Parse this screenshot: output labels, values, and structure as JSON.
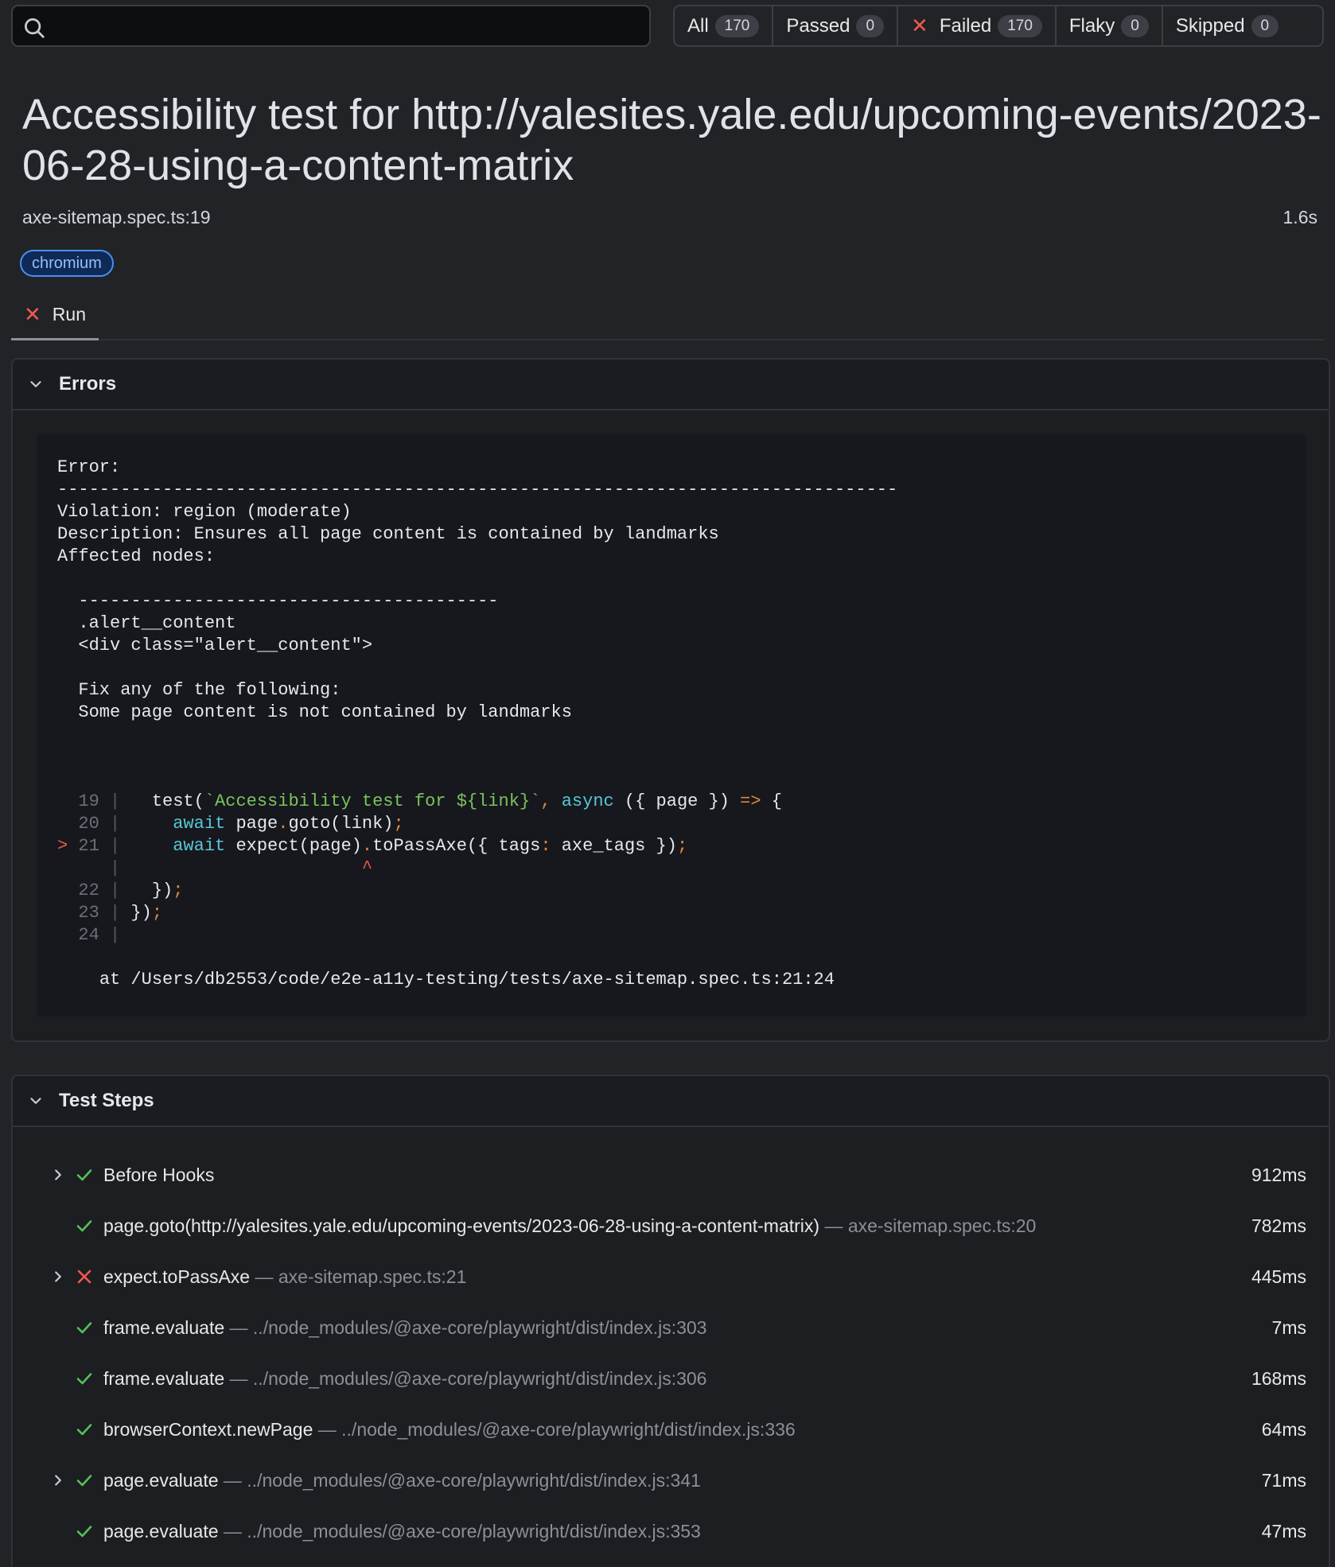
{
  "search": {
    "placeholder": ""
  },
  "filters": [
    {
      "label": "All",
      "count": "170"
    },
    {
      "label": "Passed",
      "count": "0"
    },
    {
      "label": "Failed",
      "count": "170"
    },
    {
      "label": "Flaky",
      "count": "0"
    },
    {
      "label": "Skipped",
      "count": "0"
    }
  ],
  "header": {
    "title": "Accessibility test for http://yalesites.yale.edu/upcoming-events/2023-06-28-using-a-content-matrix",
    "location": "axe-sitemap.spec.ts:19",
    "duration": "1.6s",
    "project": "chromium"
  },
  "tabs": {
    "run_label": "Run"
  },
  "errors": {
    "heading": "Errors",
    "lines": [
      "Error:",
      "--------------------------------------------------------------------------------",
      "Violation: region (moderate)",
      "Description: Ensures all page content is contained by landmarks",
      "Affected nodes:",
      "",
      "  ----------------------------------------",
      "  .alert__content",
      "  <div class=\"alert__content\">",
      "",
      "  Fix any of the following:",
      "  Some page content is not contained by landmarks"
    ],
    "source_line_numbers": [
      "19",
      "20",
      "21",
      "22",
      "23",
      "24"
    ],
    "stack": "at /Users/db2553/code/e2e-a11y-testing/tests/axe-sitemap.spec.ts:21:24"
  },
  "steps": {
    "heading": "Test Steps",
    "items": [
      {
        "name": "Before Hooks",
        "location": "",
        "duration": "912ms",
        "status": "passed",
        "expandable": true
      },
      {
        "name": "page.goto(http://yalesites.yale.edu/upcoming-events/2023-06-28-using-a-content-matrix)",
        "location": "— axe-sitemap.spec.ts:20",
        "duration": "782ms",
        "status": "passed",
        "expandable": false
      },
      {
        "name": "expect.toPassAxe",
        "location": "— axe-sitemap.spec.ts:21",
        "duration": "445ms",
        "status": "failed",
        "expandable": true
      },
      {
        "name": "frame.evaluate",
        "location": "— ../node_modules/@axe-core/playwright/dist/index.js:303",
        "duration": "7ms",
        "status": "passed",
        "expandable": false
      },
      {
        "name": "frame.evaluate",
        "location": "— ../node_modules/@axe-core/playwright/dist/index.js:306",
        "duration": "168ms",
        "status": "passed",
        "expandable": false
      },
      {
        "name": "browserContext.newPage",
        "location": "— ../node_modules/@axe-core/playwright/dist/index.js:336",
        "duration": "64ms",
        "status": "passed",
        "expandable": false
      },
      {
        "name": "page.evaluate",
        "location": "— ../node_modules/@axe-core/playwright/dist/index.js:341",
        "duration": "71ms",
        "status": "passed",
        "expandable": true
      },
      {
        "name": "page.evaluate",
        "location": "— ../node_modules/@axe-core/playwright/dist/index.js:353",
        "duration": "47ms",
        "status": "passed",
        "expandable": false
      }
    ]
  },
  "colors": {
    "failed": "#ef5a4e",
    "passed": "#4fc45a",
    "badge": "#4a8ff5"
  }
}
